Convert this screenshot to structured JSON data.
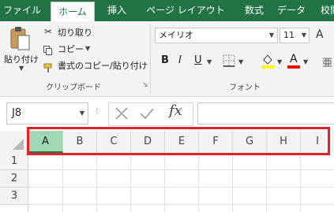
{
  "tabs": [
    {
      "label": "ファイル"
    },
    {
      "label": "ホーム"
    },
    {
      "label": "挿入"
    },
    {
      "label": "ページ レイアウト"
    },
    {
      "label": "数式"
    },
    {
      "label": "データ"
    },
    {
      "label": "校閲"
    }
  ],
  "clipboard": {
    "paste_label": "貼り付け",
    "cut_label": "切り取り",
    "copy_label": "コピー",
    "format_painter_label": "書式のコピー/貼り付け",
    "group_label": "クリップボード"
  },
  "font": {
    "font_name": "メイリオ",
    "font_size": "11",
    "bold": "B",
    "italic": "I",
    "underline": "U",
    "font_color_letter": "A",
    "grow_letter": "A",
    "group_label": "フォント",
    "font_color": "#ff0000",
    "fill_color": "#ffff00"
  },
  "formula_bar": {
    "name_box": "J8",
    "fx": "fx"
  },
  "columns": [
    "A",
    "B",
    "C",
    "D",
    "E",
    "F",
    "G",
    "H",
    "I"
  ],
  "rows": [
    "1",
    "2",
    "3"
  ],
  "colors": {
    "accent": "#217346",
    "highlight_box": "#e0222c",
    "selected_col": "#a0d8b3"
  }
}
